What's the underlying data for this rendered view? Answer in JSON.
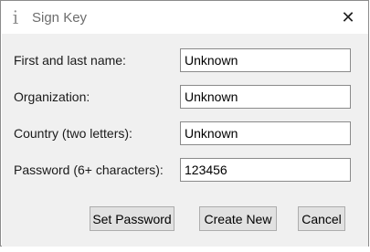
{
  "window": {
    "title": "Sign Key",
    "title_icon": "info-icon",
    "close_glyph": "✕"
  },
  "form": {
    "name_label": "First and last name:",
    "name_value": "Unknown",
    "org_label": "Organization:",
    "org_value": "Unknown",
    "country_label": "Country (two letters):",
    "country_value": "Unknown",
    "password_label": "Password (6+ characters):",
    "password_value": "123456"
  },
  "buttons": {
    "set_password": "Set Password",
    "create_new": "Create New",
    "cancel": "Cancel"
  },
  "colors": {
    "content_bg": "#f0f0f0",
    "button_bg": "#e1e1e1"
  }
}
